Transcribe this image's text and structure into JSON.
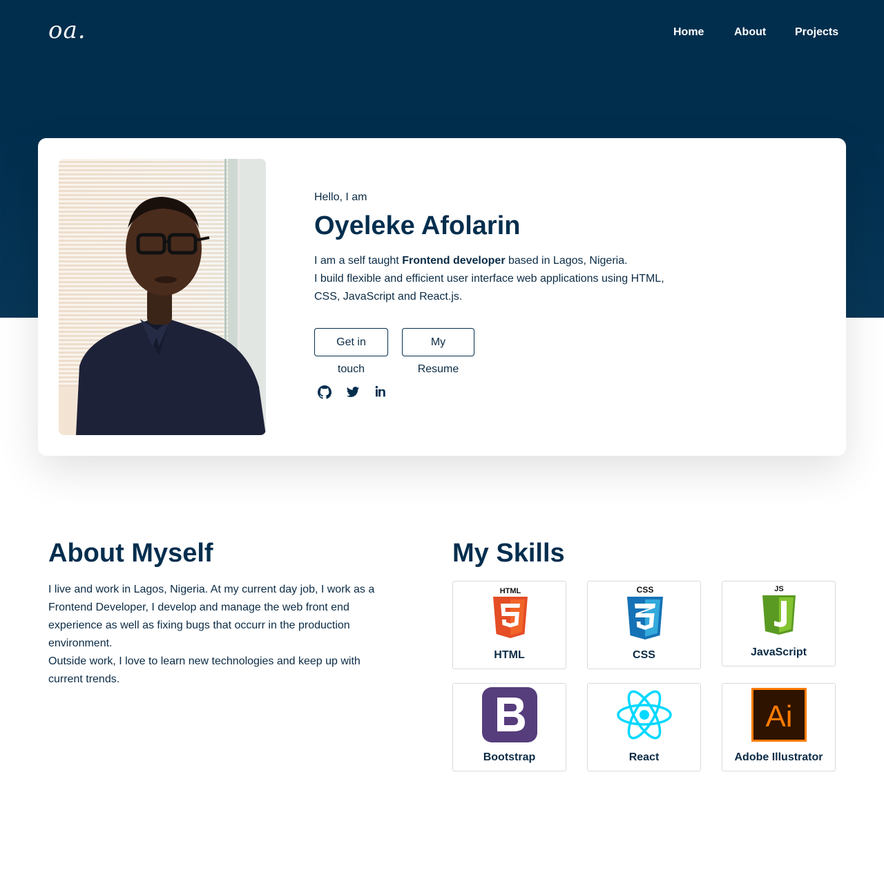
{
  "nav": {
    "logo": "oa.",
    "links": [
      "Home",
      "About",
      "Projects"
    ]
  },
  "hero": {
    "greeting": "Hello, I am",
    "name": "Oyeleke Afolarin",
    "bio_line1_pre": "I am a self taught ",
    "bio_line1_bold": "Frontend developer",
    "bio_line1_post": " based in Lagos, Nigeria.",
    "bio_line2": "I build flexible and efficient user interface web applications using HTML, CSS, JavaScript and React.js.",
    "buttons": {
      "contact": "Get in touch",
      "resume": "My Resume"
    },
    "social": [
      "github-icon",
      "twitter-icon",
      "linkedin-icon"
    ]
  },
  "about": {
    "title": "About Myself",
    "paragraph1": "I live and work in Lagos, Nigeria. At my current day job, I work as a Frontend Developer, I develop and manage the web front end experience as well as fixing bugs that occurr in the production environment.",
    "paragraph2": "Outside work, I love to learn new technologies and keep up with current trends."
  },
  "skills": {
    "title": "My Skills",
    "items": [
      {
        "label": "HTML",
        "icon": "html5-icon",
        "color": "#e44d26"
      },
      {
        "label": "CSS",
        "icon": "css3-icon",
        "color": "#1572b6"
      },
      {
        "label": "JavaScript",
        "icon": "javascript-icon",
        "color": "#6bb42b"
      },
      {
        "label": "Bootstrap",
        "icon": "bootstrap-icon",
        "color": "#563d7c"
      },
      {
        "label": "React",
        "icon": "react-icon",
        "color": "#00d8ff"
      },
      {
        "label": "Adobe Illustrator",
        "icon": "illustrator-icon",
        "color": "#ff7c00"
      }
    ]
  },
  "colors": {
    "primary": "#022e4e",
    "text": "#0b2b45",
    "white": "#ffffff"
  }
}
